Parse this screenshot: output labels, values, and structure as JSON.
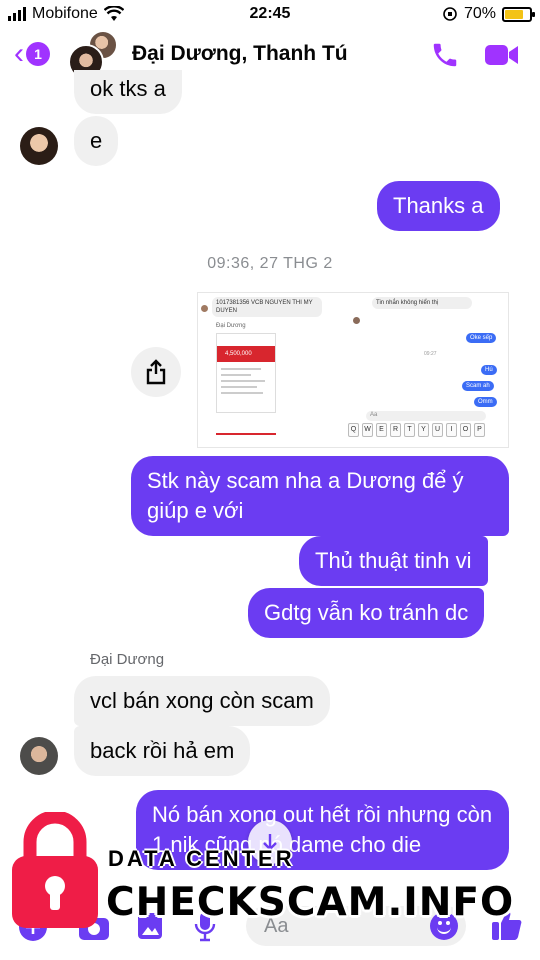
{
  "status_bar": {
    "carrier": "Mobifone",
    "time": "22:45",
    "battery": "70%"
  },
  "header": {
    "back_badge": "1",
    "title": "Đại Dương, Thanh Tú"
  },
  "messages": {
    "m1": "ok tks a",
    "m2": "e",
    "m3": "Thanks a",
    "timestamp": "09:36, 27 THG 2",
    "m4": "Stk này scam nha a Dương để ý giúp e với",
    "m5": "Thủ thuật tinh vi",
    "m6": "Gdtg vẫn ko tránh dc",
    "sender": "Đại Dương",
    "m7": "vcl bán xong còn scam",
    "m8": "back rồi hả em",
    "m9": "Nó bán xong out hết rồi nhưng còn 1 nik cũng nó dame cho die"
  },
  "attachment": {
    "account_line": "1017381356 VCB NGUYEN THI MY DUYEN",
    "sender_name": "Đại Dương",
    "amount": "4,500,000",
    "hidden_msg_title": "Tin nhắn không hiển thị",
    "reply_1": "Oke sếp",
    "time": "09:27",
    "reply_2": "Hú",
    "reply_3": "Scam ah",
    "reply_4": "Omm",
    "input_placeholder": "Aa",
    "keys": [
      "Q",
      "W",
      "E",
      "R",
      "T",
      "Y",
      "U",
      "I",
      "O",
      "P"
    ]
  },
  "composer": {
    "placeholder": "Aa"
  },
  "watermark": {
    "top": "DATA CENTER",
    "main": "CHECKSCAM.INFO"
  },
  "colors": {
    "accent": "#a033ff",
    "outgoing_bubble": "#6b3cf2",
    "incoming_bubble": "#f0f0f0"
  }
}
